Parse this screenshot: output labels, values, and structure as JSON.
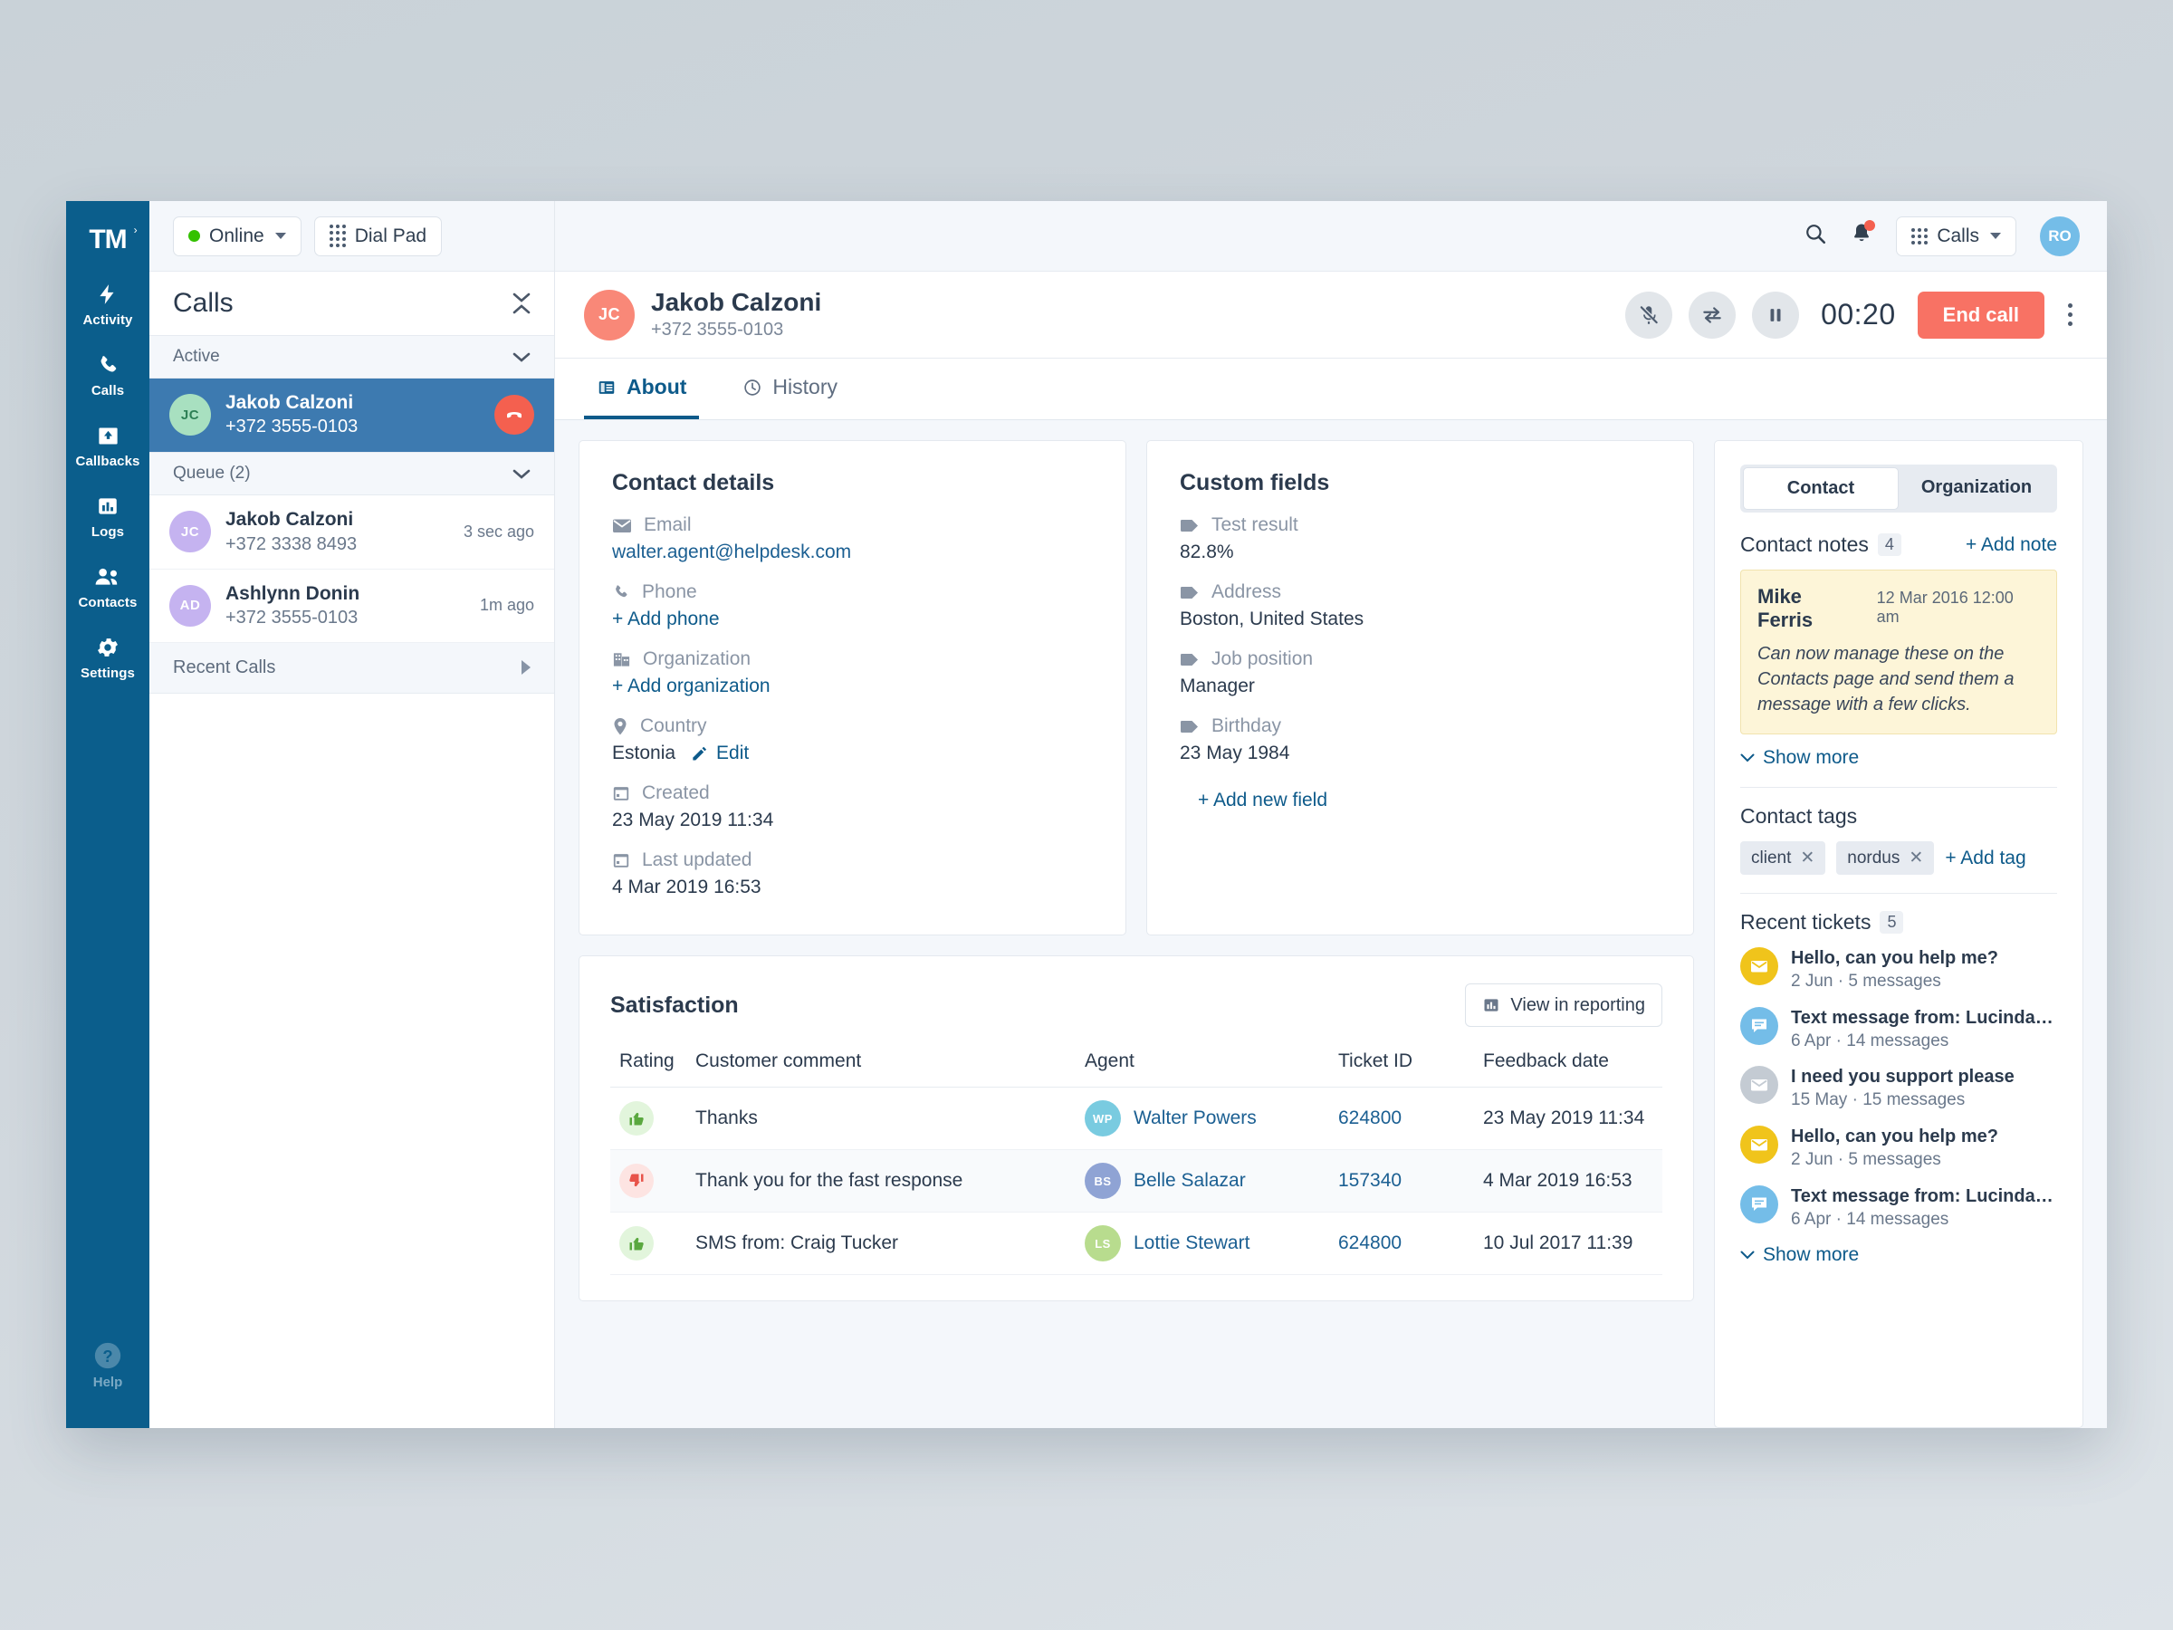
{
  "brand": {
    "logo": "TM",
    "rail_bg": "#0b5e8c",
    "accent": "#0d5a8a",
    "danger": "#f4604f"
  },
  "rail": {
    "items": [
      {
        "label": "Activity",
        "icon": "bolt-icon"
      },
      {
        "label": "Calls",
        "icon": "phone-icon"
      },
      {
        "label": "Callbacks",
        "icon": "callback-inbox-icon"
      },
      {
        "label": "Logs",
        "icon": "bar-chart-icon"
      },
      {
        "label": "Contacts",
        "icon": "people-icon"
      },
      {
        "label": "Settings",
        "icon": "gear-icon"
      }
    ],
    "help": {
      "label": "Help",
      "icon": "question-circle-icon"
    }
  },
  "topbar": {
    "status": "Online",
    "dialpad": "Dial Pad",
    "search_icon": "search-icon",
    "bell_icon": "bell-icon",
    "apps_label": "Calls",
    "user_initials": "RO"
  },
  "calls_panel": {
    "title": "Calls",
    "groups": [
      {
        "label": "Active"
      },
      {
        "label": "Queue (2)"
      }
    ],
    "active_call": {
      "initials": "JC",
      "name": "Jakob Calzoni",
      "phone": "+372 3555-0103",
      "avatar_color": "#a8e0c0"
    },
    "queue": [
      {
        "initials": "JC",
        "name": "Jakob Calzoni",
        "phone": "+372 3338 8493",
        "ago": "3 sec ago",
        "avatar_color": "#c5b3f0"
      },
      {
        "initials": "AD",
        "name": "Ashlynn Donin",
        "phone": "+372 3555-0103",
        "ago": "1m ago",
        "avatar_color": "#c5b3f0"
      }
    ],
    "recent": "Recent Calls"
  },
  "call_header": {
    "initials": "JC",
    "avatar_color": "#f98878",
    "name": "Jakob Calzoni",
    "phone": "+372 3555-0103",
    "timer": "00:20",
    "end_call": "End call",
    "controls": [
      "mute-icon",
      "transfer-icon",
      "pause-icon"
    ]
  },
  "tabs": [
    {
      "label": "About",
      "icon": "about-card-icon",
      "active": true
    },
    {
      "label": "History",
      "icon": "clock-icon",
      "active": false
    }
  ],
  "contact_details": {
    "title": "Contact details",
    "fields": [
      {
        "icon": "envelope-icon",
        "label": "Email",
        "value": "walter.agent@helpdesk.com",
        "link": true
      },
      {
        "icon": "phone-icon",
        "label": "Phone",
        "action": "+ Add phone"
      },
      {
        "icon": "building-icon",
        "label": "Organization",
        "action": "+ Add organization"
      },
      {
        "icon": "pin-icon",
        "label": "Country",
        "value": "Estonia",
        "edit": "Edit"
      },
      {
        "icon": "calendar-icon",
        "label": "Created",
        "value": "23 May 2019 11:34"
      },
      {
        "icon": "calendar-icon",
        "label": "Last updated",
        "value": "4 Mar 2019 16:53"
      }
    ]
  },
  "custom_fields": {
    "title": "Custom fields",
    "fields": [
      {
        "icon": "tag-icon",
        "label": "Test result",
        "value": "82.8%"
      },
      {
        "icon": "tag-icon",
        "label": "Address",
        "value": "Boston, United States"
      },
      {
        "icon": "tag-icon",
        "label": "Job position",
        "value": "Manager"
      },
      {
        "icon": "tag-icon",
        "label": "Birthday",
        "value": "23 May 1984"
      }
    ],
    "add_field": "+ Add new field"
  },
  "satisfaction": {
    "title": "Satisfaction",
    "report_button": "View in reporting",
    "columns": [
      "Rating",
      "Customer comment",
      "Agent",
      "Ticket ID",
      "Feedback date"
    ],
    "rows": [
      {
        "rating": "up",
        "comment": "Thanks",
        "agent": "Walter  Powers",
        "agent_initials": "WP",
        "agent_color": "#79cbe0",
        "ticket": "624800",
        "date": "23 May 2019 11:34"
      },
      {
        "rating": "down",
        "comment": "Thank you for the fast response",
        "agent": "Belle  Salazar",
        "agent_initials": "BS",
        "agent_color": "#8fa3d4",
        "ticket": "157340",
        "date": "4 Mar 2019 16:53"
      },
      {
        "rating": "up",
        "comment": "SMS from: Craig Tucker",
        "agent": "Lottie  Stewart",
        "agent_initials": "LS",
        "agent_color": "#b8dc8e",
        "ticket": "624800",
        "date": "10 Jul 2017 11:39"
      }
    ]
  },
  "right_panel": {
    "segments": [
      {
        "label": "Contact",
        "active": true
      },
      {
        "label": "Organization",
        "active": false
      }
    ],
    "notes": {
      "title": "Contact notes",
      "count": "4",
      "add": "+ Add note",
      "items": [
        {
          "author": "Mike Ferris",
          "date": "12 Mar 2016 12:00 am",
          "body": "Can now manage these on the Contacts page and send them a message with a few clicks."
        }
      ],
      "show_more": "Show more"
    },
    "tags": {
      "title": "Contact tags",
      "items": [
        "client",
        "nordus"
      ],
      "add": "+ Add tag"
    },
    "tickets": {
      "title": "Recent tickets",
      "count": "5",
      "items": [
        {
          "subject": "Hello, can you help me?",
          "meta": "2 Jun · 5 messages",
          "icon": "envelope-icon",
          "color": "#f0c41b"
        },
        {
          "subject": "Text message from: Lucinda Mc...",
          "meta": "6 Apr · 14 messages",
          "icon": "chat-icon",
          "color": "#74bde8"
        },
        {
          "subject": "I need you support please",
          "meta": "15 May · 15 messages",
          "icon": "envelope-icon",
          "color": "#c4cbd3"
        },
        {
          "subject": "Hello, can you help me?",
          "meta": "2 Jun · 5 messages",
          "icon": "envelope-icon",
          "color": "#f0c41b"
        },
        {
          "subject": "Text message from: Lucinda Mc...",
          "meta": "6 Apr · 14 messages",
          "icon": "chat-icon",
          "color": "#74bde8"
        }
      ],
      "show_more": "Show more"
    }
  }
}
